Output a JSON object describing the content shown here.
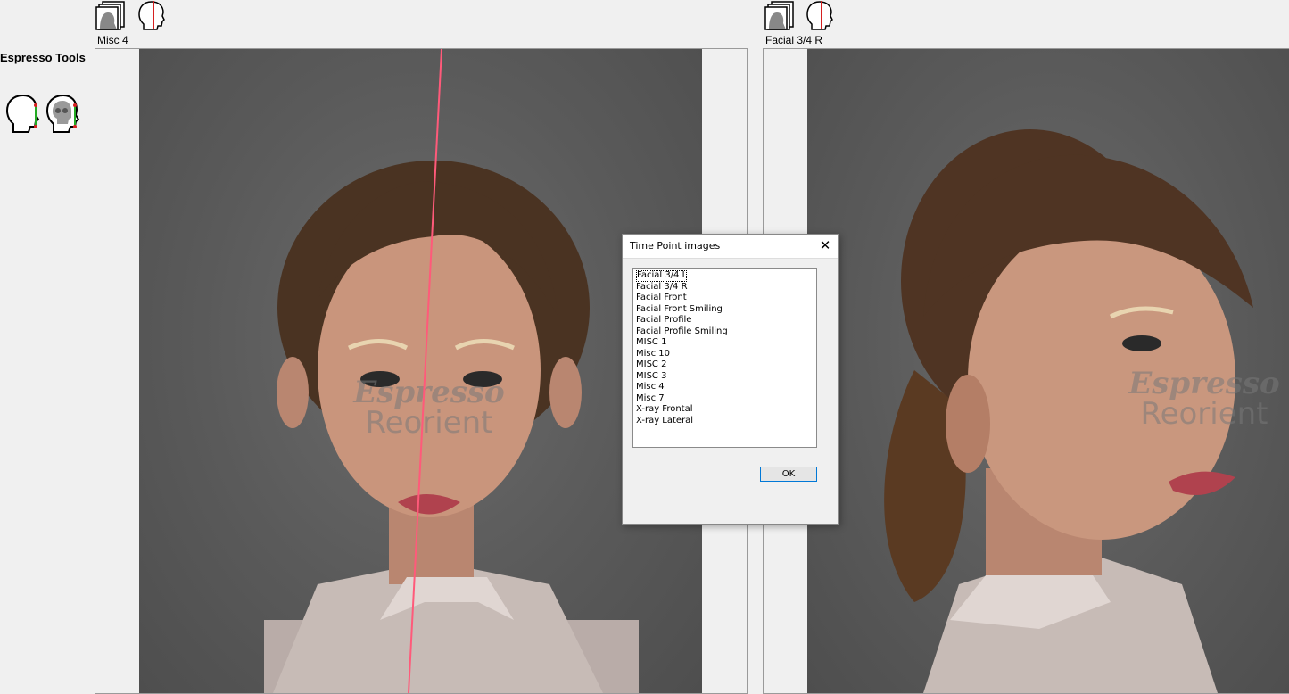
{
  "tools": {
    "title": "Espresso Tools",
    "buttons": [
      {
        "name": "soft-tissue-profile-tool",
        "icon": "head-profile-icon"
      },
      {
        "name": "skull-profile-tool",
        "icon": "skull-profile-icon"
      }
    ]
  },
  "panels": [
    {
      "label": "Misc 4",
      "toolbar": [
        {
          "name": "image-stack-icon"
        },
        {
          "name": "head-midline-icon"
        }
      ],
      "watermark": {
        "line1": "Espresso",
        "line2": "Reorient"
      }
    },
    {
      "label": "Facial 3/4 R",
      "toolbar": [
        {
          "name": "image-stack-icon"
        },
        {
          "name": "head-midline-icon"
        }
      ],
      "watermark": {
        "line1": "Espresso",
        "line2": "Reorient"
      }
    }
  ],
  "dialog": {
    "title": "Time Point images",
    "close_glyph": "✕",
    "items": [
      "Facial 3/4 L",
      "Facial 3/4 R",
      "Facial Front",
      "Facial Front Smiling",
      "Facial Profile",
      "Facial Profile Smiling",
      "MISC 1",
      "Misc 10",
      "MISC 2",
      "MISC 3",
      "Misc 4",
      "Misc 7",
      "X-ray Frontal",
      "X-ray Lateral"
    ],
    "focused_index": 0,
    "ok_label": "OK"
  },
  "colors": {
    "midline": "#ff5a7a",
    "accent_blue": "#0078d7",
    "icon_red": "#d62020",
    "icon_green": "#22aa22"
  }
}
